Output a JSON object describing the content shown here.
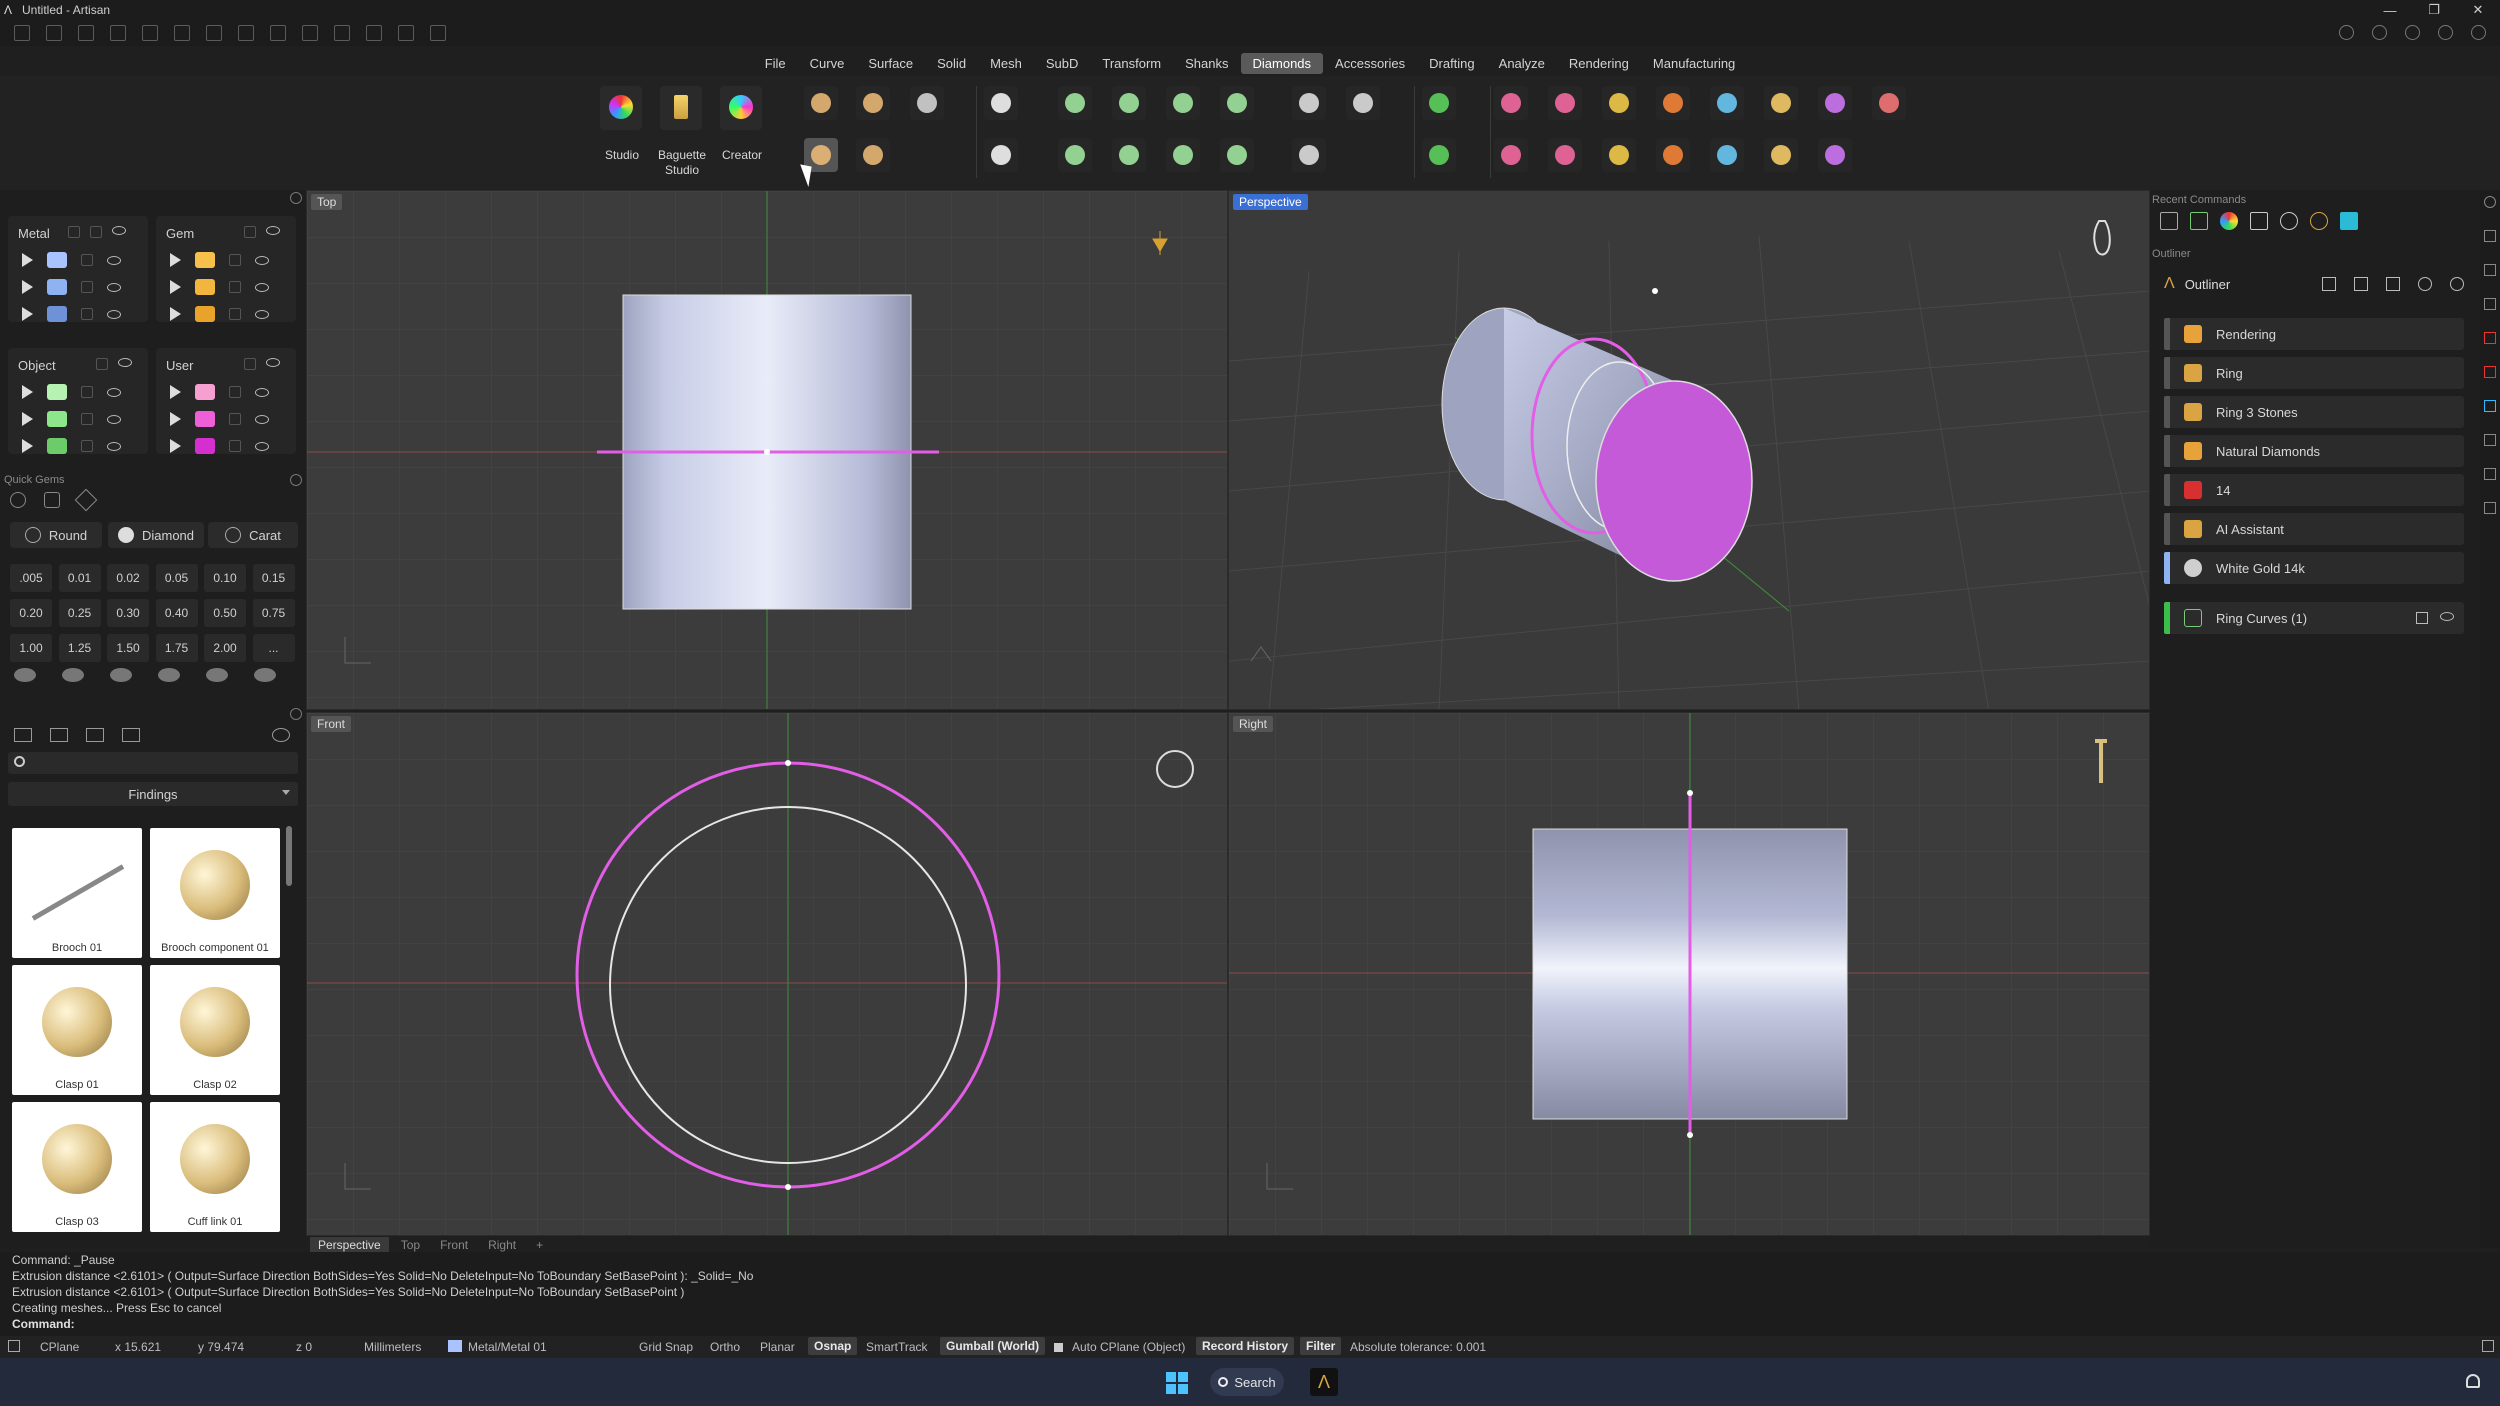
{
  "window": {
    "title": "Untitled - Artisan",
    "controls": [
      "—",
      "❐",
      "✕"
    ]
  },
  "menu": [
    "File",
    "Curve",
    "Surface",
    "Solid",
    "Mesh",
    "SubD",
    "Transform",
    "Shanks",
    "Diamonds",
    "Accessories",
    "Drafting",
    "Analyze",
    "Rendering",
    "Manufacturing"
  ],
  "menu_active": "Diamonds",
  "ribbon": {
    "studio": "Studio",
    "baguette": "Baguette\nStudio",
    "creator": "Creator"
  },
  "layers": {
    "metal": "Metal",
    "gem": "Gem",
    "object": "Object",
    "user": "User",
    "metal_colors": [
      "#a9c3ff",
      "#8fb2f2",
      "#6f91d8"
    ],
    "gem_colors": [
      "#f6c04a",
      "#f2b53e",
      "#e9a22a"
    ],
    "object_colors": [
      "#b6f2b0",
      "#8ee68a",
      "#6ccc6a"
    ],
    "user_colors": [
      "#f6a0d2",
      "#ee5fd8",
      "#d62fd0"
    ]
  },
  "quick_gems": {
    "title": "Quick Gems",
    "round": "Round",
    "diamond": "Diamond",
    "carat": "Carat",
    "sizes": [
      ".005",
      "0.01",
      "0.02",
      "0.05",
      "0.10",
      "0.15",
      "0.20",
      "0.25",
      "0.30",
      "0.40",
      "0.50",
      "0.75",
      "1.00",
      "1.25",
      "1.50",
      "1.75",
      "2.00",
      "..."
    ]
  },
  "library": {
    "category": "Findings",
    "items": [
      "Brooch 01",
      "Brooch component 01",
      "Clasp 01",
      "Clasp 02",
      "Clasp 03",
      "Cuff link 01"
    ]
  },
  "viewports": {
    "top": "Top",
    "perspective": "Perspective",
    "front": "Front",
    "right": "Right"
  },
  "view_tabs": [
    "Perspective",
    "Top",
    "Front",
    "Right",
    "+"
  ],
  "right_panel": {
    "recent": "Recent Commands",
    "outliner_header": "Outliner",
    "outliner_title": "Outliner",
    "items": [
      {
        "label": "Rendering",
        "color": "#e8a23a"
      },
      {
        "label": "Ring",
        "color": "#d9a441"
      },
      {
        "label": "Ring 3 Stones",
        "color": "#d9a441"
      },
      {
        "label": "Natural Diamonds",
        "color": "#e8a23a"
      },
      {
        "label": "14",
        "color": "#d63030"
      },
      {
        "label": "AI Assistant",
        "color": "#d9a441"
      },
      {
        "label": "White Gold 14k",
        "color": "#cfcfcf"
      }
    ],
    "ring_curves": "Ring Curves (1)"
  },
  "command": {
    "lines": [
      "Command: _Pause",
      "Extrusion distance <2.6101> ( Output=Surface  Direction  BothSides=Yes  Solid=No  DeleteInput=No  ToBoundary  SetBasePoint ): _Solid=_No",
      "Extrusion distance <2.6101> ( Output=Surface  Direction  BothSides=Yes  Solid=No  DeleteInput=No  ToBoundary  SetBasePoint )",
      "Creating meshes... Press Esc to cancel"
    ],
    "prompt": "Command:"
  },
  "status": {
    "cplane": "CPlane",
    "x": "x 15.621",
    "y": "y 79.474",
    "z": "z 0",
    "units": "Millimeters",
    "layer": "Metal/Metal 01",
    "grid_snap": "Grid Snap",
    "ortho": "Ortho",
    "planar": "Planar",
    "osnap": "Osnap",
    "smarttrack": "SmartTrack",
    "gumball": "Gumball (World)",
    "auto_cplane": "Auto CPlane (Object)",
    "record_history": "Record History",
    "filter": "Filter",
    "tolerance": "Absolute tolerance: 0.001"
  },
  "taskbar": {
    "search": "Search"
  }
}
